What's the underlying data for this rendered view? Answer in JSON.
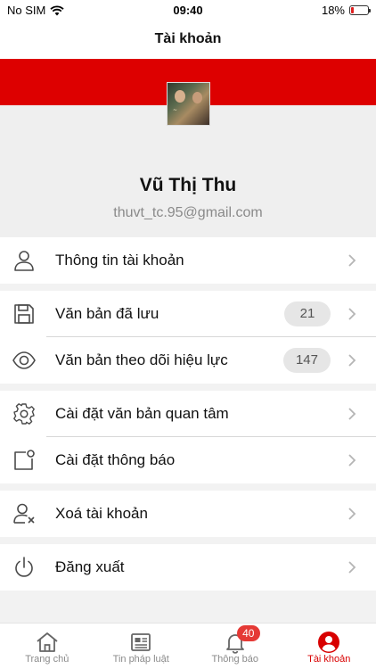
{
  "status_bar": {
    "carrier": "No SIM",
    "time": "09:40",
    "battery_percent": "18%",
    "battery_level": 0.18
  },
  "nav": {
    "title": "Tài khoản"
  },
  "profile": {
    "name": "Vũ Thị Thu",
    "email": "thuvt_tc.95@gmail.com",
    "avatar_icon": "user-photo"
  },
  "menu": {
    "groups": [
      [
        {
          "label": "Thông tin tài khoản",
          "icon": "user-icon"
        }
      ],
      [
        {
          "label": "Văn bản đã lưu",
          "icon": "save-icon",
          "badge": "21"
        },
        {
          "label": "Văn bản theo dõi hiệu lực",
          "icon": "eye-icon",
          "badge": "147"
        }
      ],
      [
        {
          "label": "Cài đặt văn bản quan tâm",
          "icon": "gear-icon"
        },
        {
          "label": "Cài đặt thông báo",
          "icon": "notification-settings-icon"
        }
      ],
      [
        {
          "label": "Xoá tài khoản",
          "icon": "delete-user-icon"
        }
      ],
      [
        {
          "label": "Đăng xuất",
          "icon": "power-icon"
        }
      ]
    ]
  },
  "tabs": [
    {
      "label": "Trang chủ",
      "icon": "home-icon",
      "active": false
    },
    {
      "label": "Tin pháp luật",
      "icon": "newspaper-icon",
      "active": false
    },
    {
      "label": "Thông báo",
      "icon": "bell-icon",
      "active": false,
      "badge": "40"
    },
    {
      "label": "Tài khoản",
      "icon": "account-icon",
      "active": true
    }
  ],
  "colors": {
    "brand_red": "#dd0000",
    "active_tab": "#d80000",
    "badge_red": "#e53935",
    "icon_gray": "#4a4a4a"
  }
}
